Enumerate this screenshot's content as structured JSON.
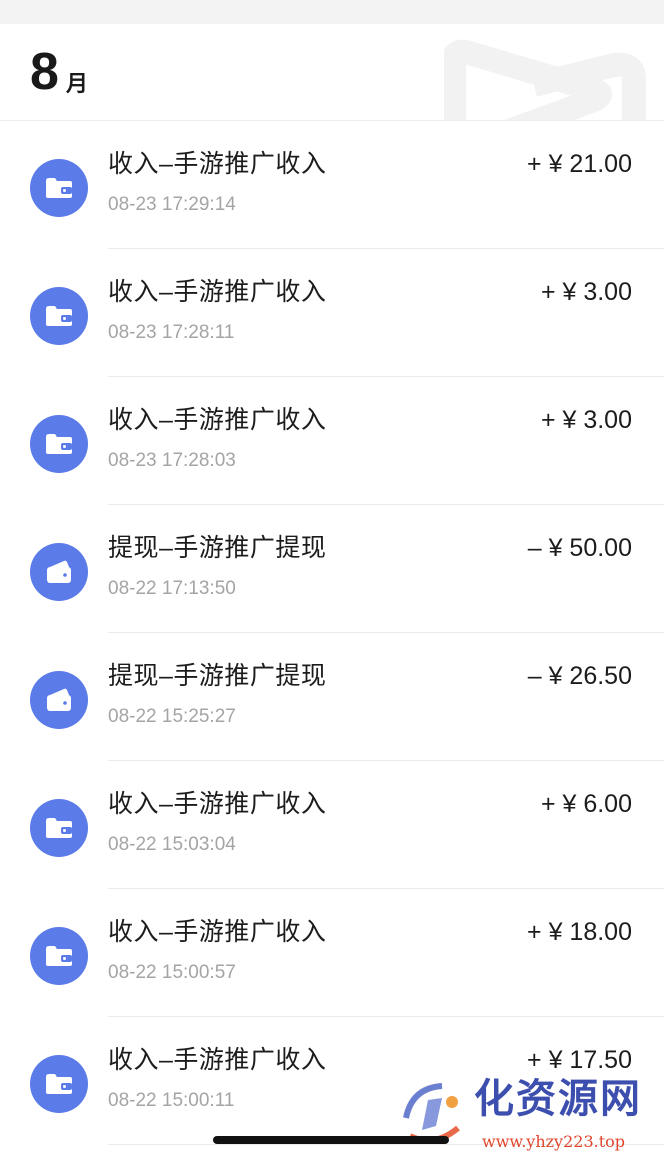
{
  "header": {
    "month_number": "8",
    "month_unit": "月"
  },
  "colors": {
    "icon_bg": "#5b7be8",
    "divider": "#ebebeb",
    "secondary_text": "#a4a4a4"
  },
  "transactions": [
    {
      "type": "income",
      "icon": "wallet-icon",
      "title": "收入–手游推广收入",
      "time": "08-23 17:29:14",
      "amount": "+ ¥ 21.00"
    },
    {
      "type": "income",
      "icon": "wallet-icon",
      "title": "收入–手游推广收入",
      "time": "08-23 17:28:11",
      "amount": "+ ¥ 3.00"
    },
    {
      "type": "income",
      "icon": "wallet-icon",
      "title": "收入–手游推广收入",
      "time": "08-23 17:28:03",
      "amount": "+ ¥ 3.00"
    },
    {
      "type": "withdraw",
      "icon": "withdraw-wallet-icon",
      "title": "提现–手游推广提现",
      "time": "08-22 17:13:50",
      "amount": "– ¥ 50.00"
    },
    {
      "type": "withdraw",
      "icon": "withdraw-wallet-icon",
      "title": "提现–手游推广提现",
      "time": "08-22 15:25:27",
      "amount": "– ¥ 26.50"
    },
    {
      "type": "income",
      "icon": "wallet-icon",
      "title": "收入–手游推广收入",
      "time": "08-22 15:03:04",
      "amount": "+ ¥ 6.00"
    },
    {
      "type": "income",
      "icon": "wallet-icon",
      "title": "收入–手游推广收入",
      "time": "08-22 15:00:57",
      "amount": "+ ¥ 18.00"
    },
    {
      "type": "income",
      "icon": "wallet-icon",
      "title": "收入–手游推广收入",
      "time": "08-22 15:00:11",
      "amount": "+ ¥ 17.50"
    }
  ],
  "watermark": {
    "title": "化资源网",
    "url": "www.yhzy223.top"
  }
}
